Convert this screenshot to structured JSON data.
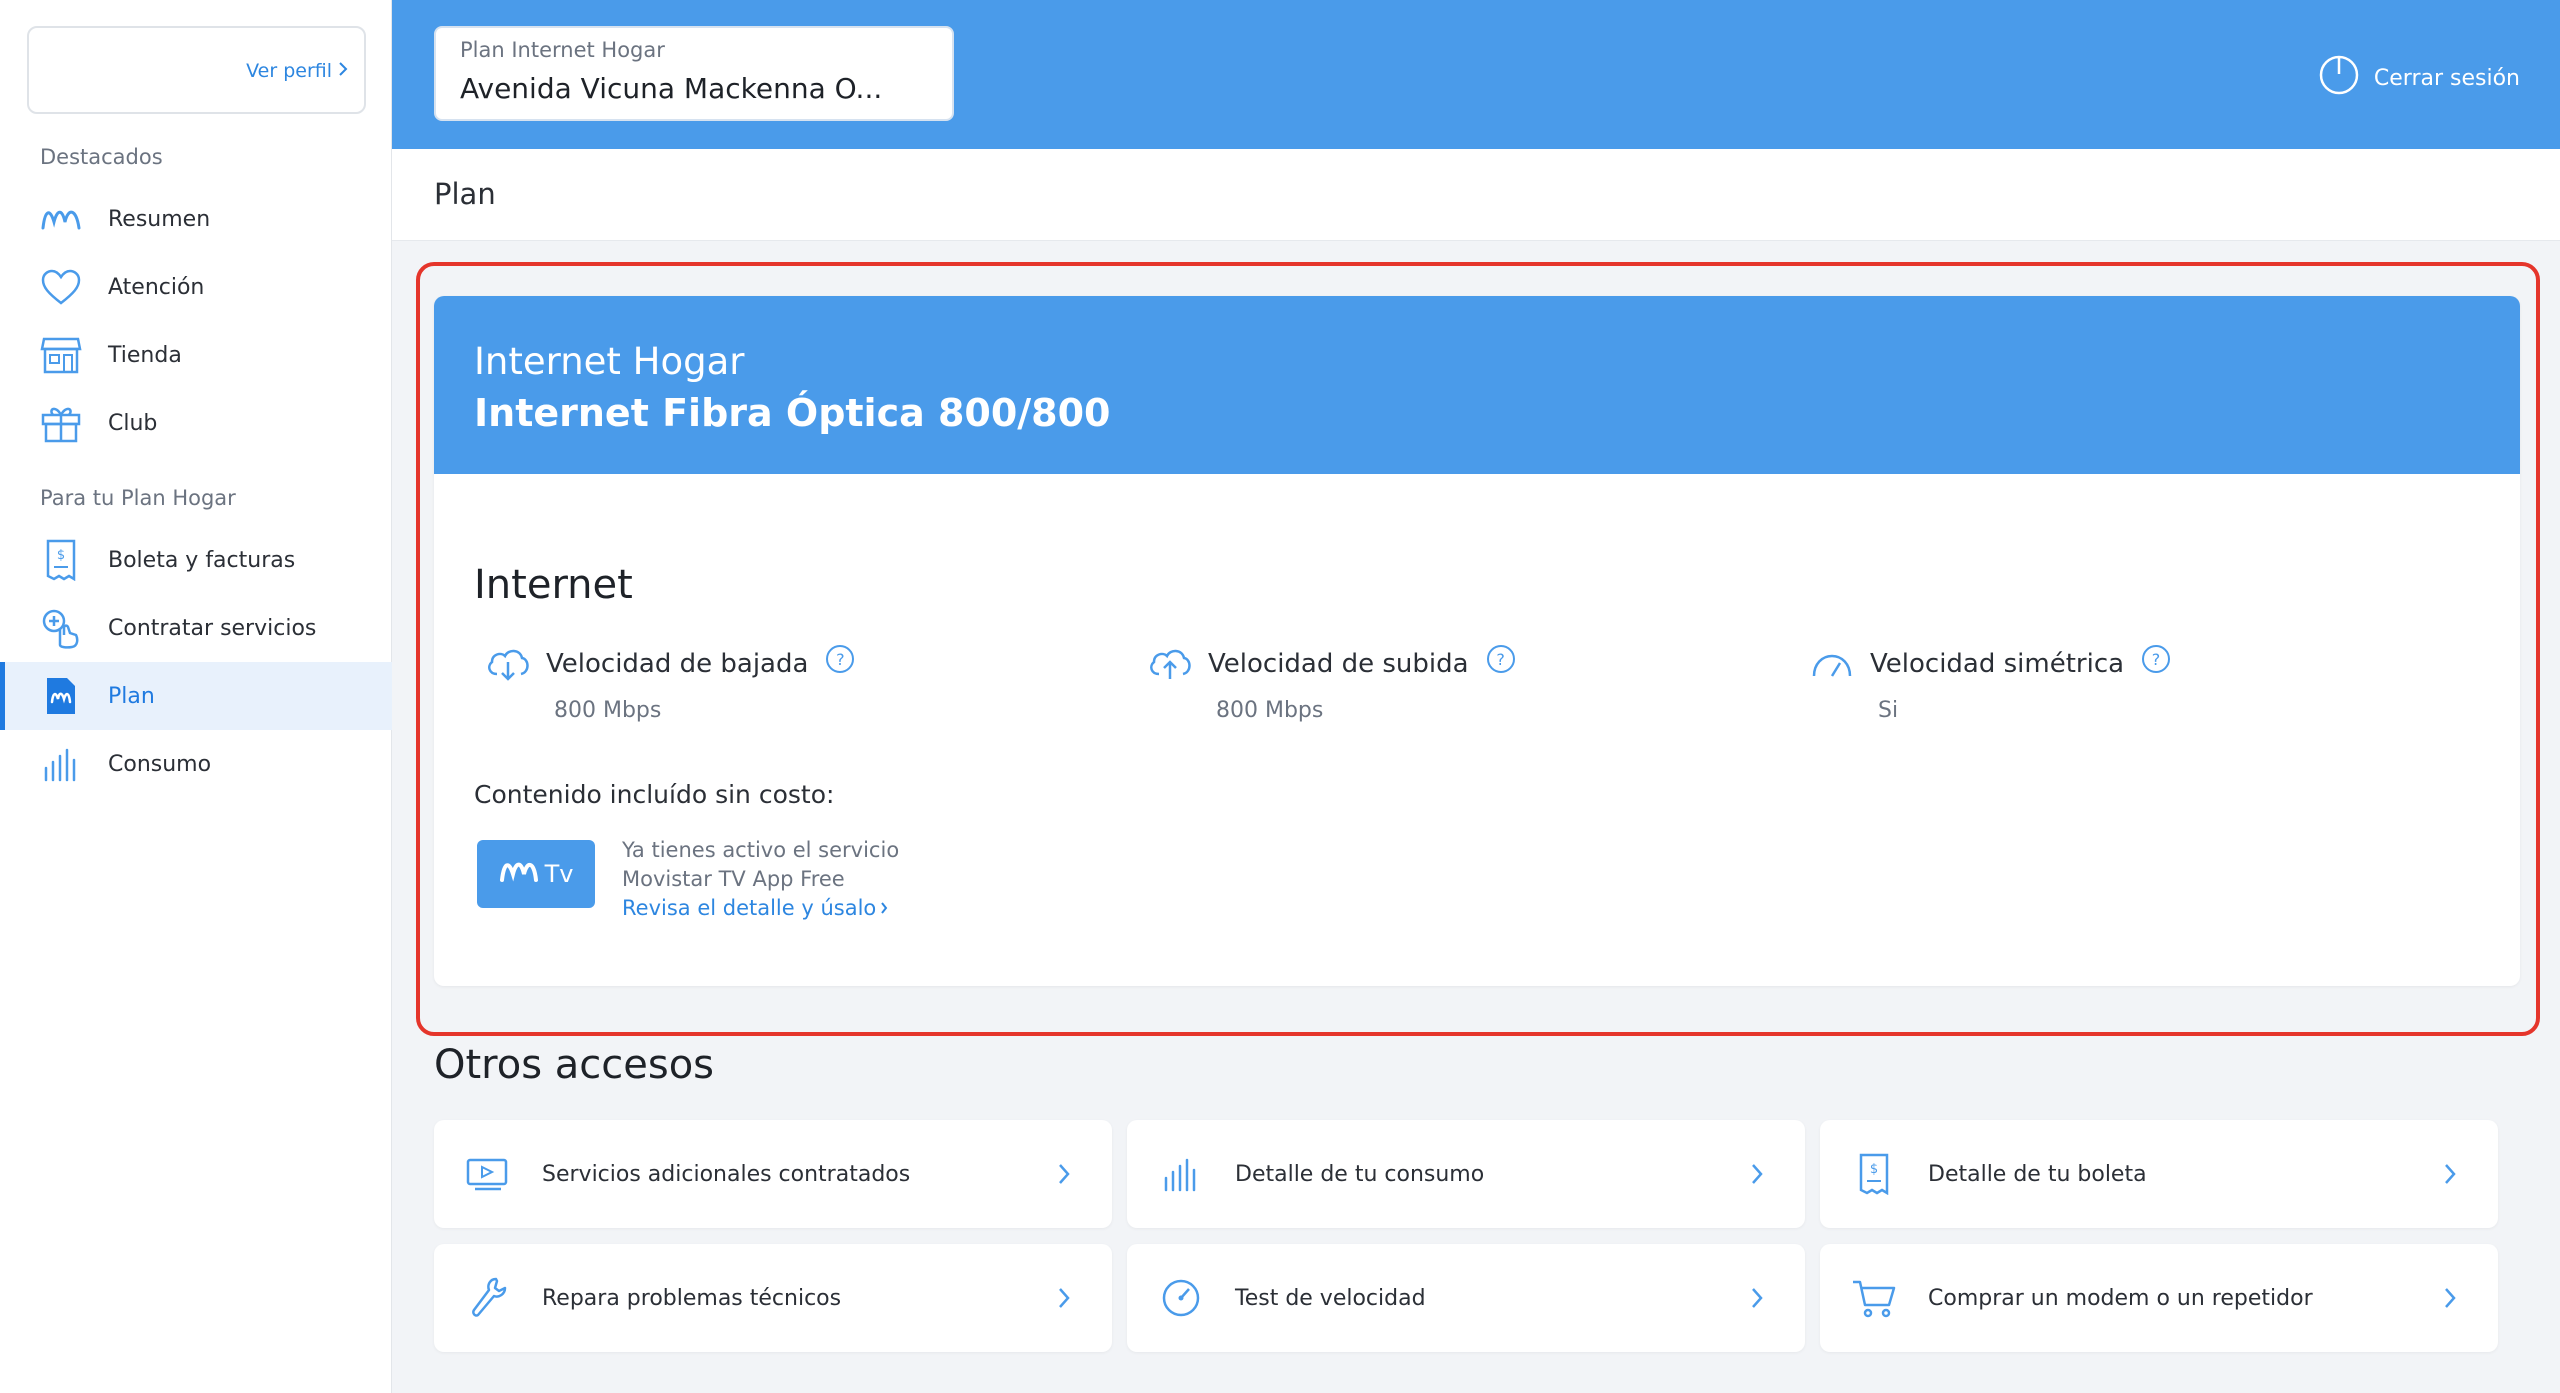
{
  "sidebar": {
    "profile_link": "Ver perfil",
    "sections": [
      {
        "title": "Destacados"
      },
      {
        "title": "Para tu Plan Hogar"
      }
    ],
    "items": [
      {
        "label": "Resumen",
        "icon": "movistar-logo-icon"
      },
      {
        "label": "Atención",
        "icon": "heart-icon"
      },
      {
        "label": "Tienda",
        "icon": "store-icon"
      },
      {
        "label": "Club",
        "icon": "gift-icon"
      },
      {
        "label": "Boleta y facturas",
        "icon": "invoice-icon"
      },
      {
        "label": "Contratar servicios",
        "icon": "touch-plus-icon"
      },
      {
        "label": "Plan",
        "icon": "plan-document-icon",
        "active": true
      },
      {
        "label": "Consumo",
        "icon": "bar-chart-icon"
      }
    ]
  },
  "header": {
    "plan_select_label": "Plan Internet Hogar",
    "plan_select_value": "Avenida Vicuna Mackenna O...",
    "logout_label": "Cerrar sesión"
  },
  "page": {
    "title": "Plan"
  },
  "plan_card": {
    "banner_line1": "Internet Hogar",
    "banner_line2": "Internet Fibra Óptica 800/800",
    "section_title": "Internet",
    "speeds": [
      {
        "label": "Velocidad de bajada",
        "value": "800 Mbps",
        "icon": "cloud-download-icon"
      },
      {
        "label": "Velocidad de subida",
        "value": "800 Mbps",
        "icon": "cloud-upload-icon"
      },
      {
        "label": "Velocidad simétrica",
        "value": "Si",
        "icon": "speedometer-icon"
      }
    ],
    "help_glyph": "?",
    "included_title": "Contenido incluído sin costo:",
    "tv": {
      "logo_text": "Tv",
      "line1": "Ya tienes activo el servicio",
      "line2": "Movistar TV App Free",
      "link": "Revisa el detalle y úsalo"
    }
  },
  "otros": {
    "title": "Otros accesos",
    "items": [
      {
        "label": "Servicios adicionales contratados",
        "icon": "tv-services-icon"
      },
      {
        "label": "Detalle de tu consumo",
        "icon": "bar-chart-icon"
      },
      {
        "label": "Detalle de tu boleta",
        "icon": "invoice-icon"
      },
      {
        "label": "Repara problemas técnicos",
        "icon": "wrench-icon"
      },
      {
        "label": "Test de velocidad",
        "icon": "speedometer-icon"
      },
      {
        "label": "Comprar un modem o un repetidor",
        "icon": "cart-icon"
      }
    ]
  },
  "colors": {
    "brand_blue": "#4a9bea",
    "link_blue": "#2d86e0",
    "highlight_red": "#e5352b"
  }
}
